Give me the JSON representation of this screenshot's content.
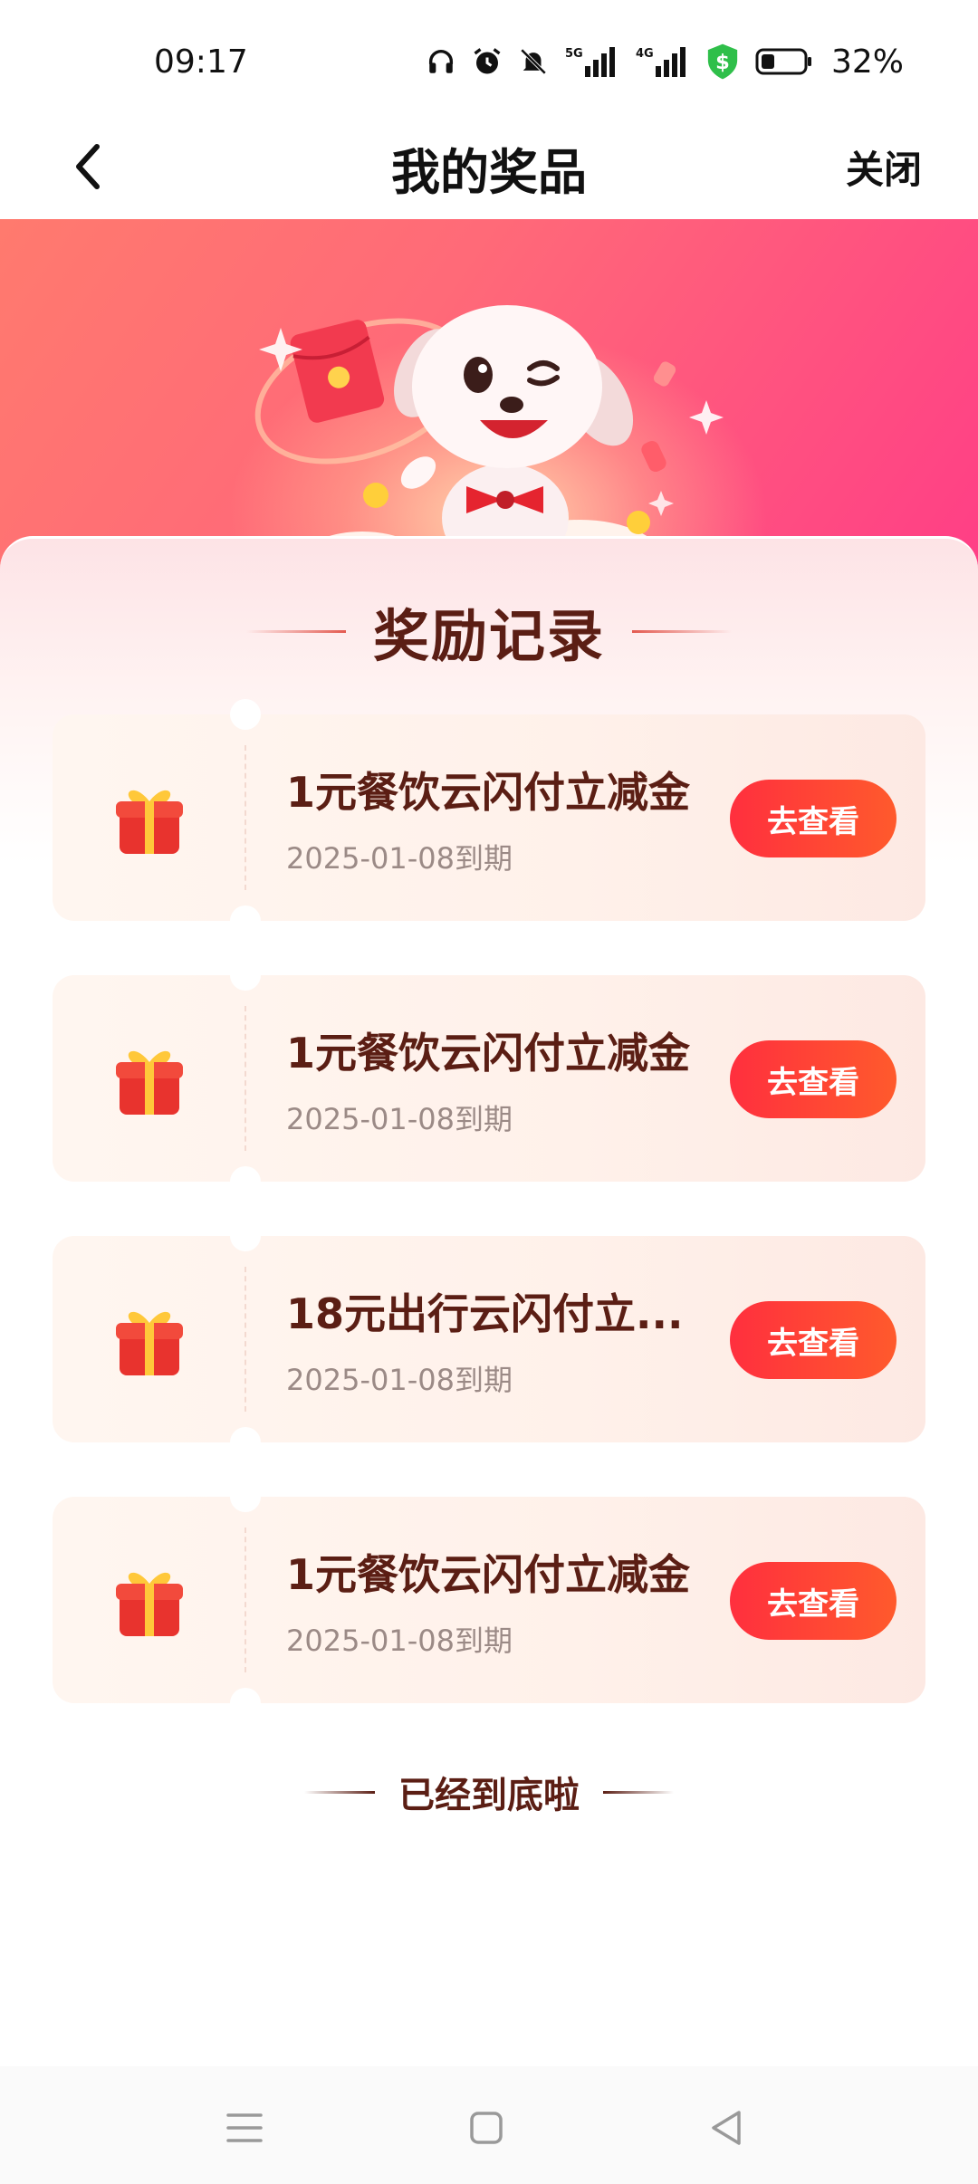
{
  "status_bar": {
    "time": "09:17",
    "battery_percent": "32%",
    "signal_1": "5G",
    "signal_2": "4G",
    "icons": [
      "headphones-icon",
      "alarm-icon",
      "mute-icon",
      "signal-5g-icon",
      "signal-4g-icon",
      "shield-dollar-icon",
      "battery-icon"
    ]
  },
  "nav": {
    "title": "我的奖品",
    "close_label": "关闭",
    "back_icon": "chevron-left-icon"
  },
  "section": {
    "title": "奖励记录"
  },
  "prizes": [
    {
      "name": "1元餐饮云闪付立减金",
      "expiry": "2025-01-08到期",
      "button": "去查看"
    },
    {
      "name": "1元餐饮云闪付立减金",
      "expiry": "2025-01-08到期",
      "button": "去查看"
    },
    {
      "name": "18元出行云闪付立...",
      "expiry": "2025-01-08到期",
      "button": "去查看"
    },
    {
      "name": "1元餐饮云闪付立减金",
      "expiry": "2025-01-08到期",
      "button": "去查看"
    }
  ],
  "footer": {
    "end_text": "已经到底啦"
  },
  "system_nav": {
    "icons": [
      "menu-icon",
      "home-square-icon",
      "back-triangle-icon"
    ]
  },
  "colors": {
    "accent_button_start": "#ff2f3e",
    "accent_button_end": "#ff5a2c",
    "title_brown": "#5b1e14",
    "hero_pink": "#ff3e86"
  }
}
